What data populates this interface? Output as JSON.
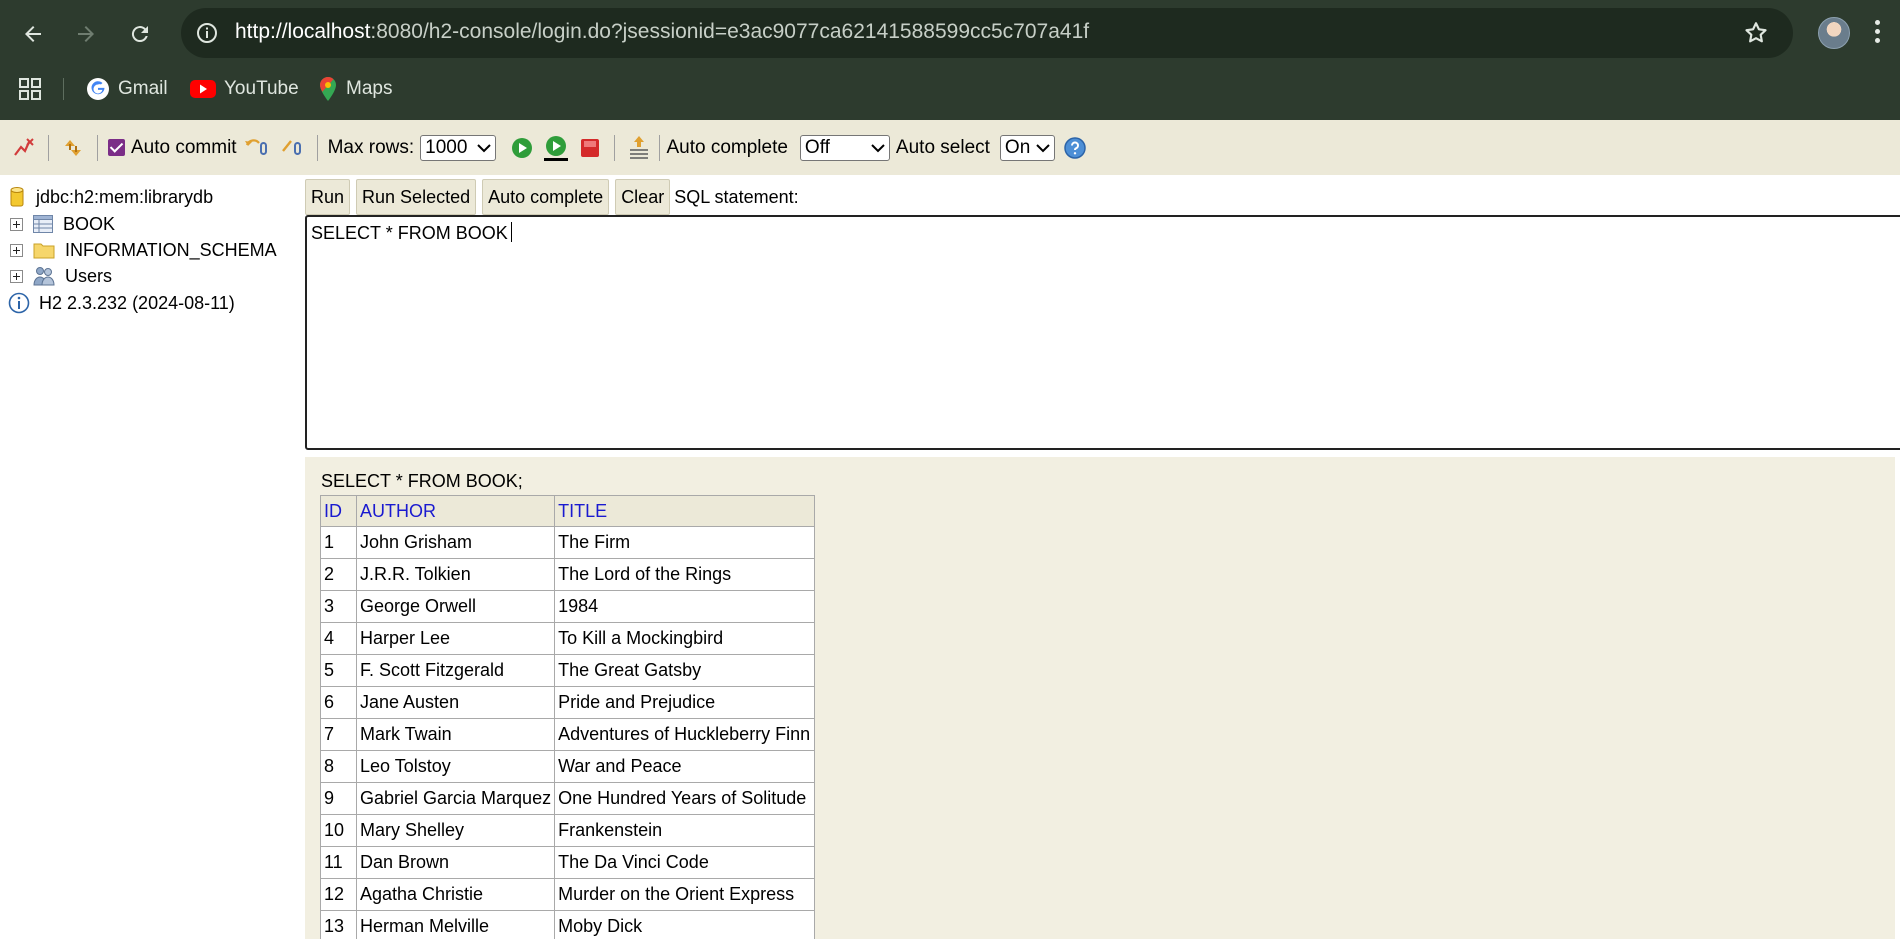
{
  "browser": {
    "url_host": "http://localhost",
    "url_rest": ":8080/h2-console/login.do?jsessionid=e3ac9077ca62141588599cc5c707a41f",
    "bookmarks": [
      {
        "label": "Gmail",
        "icon": "google-icon"
      },
      {
        "label": "YouTube",
        "icon": "youtube-icon"
      },
      {
        "label": "Maps",
        "icon": "maps-icon"
      }
    ]
  },
  "toolbar": {
    "auto_commit_label": "Auto commit",
    "auto_commit_checked": true,
    "max_rows_label": "Max rows:",
    "max_rows_value": "1000",
    "auto_complete_label": "Auto complete",
    "auto_complete_value": "Off",
    "auto_select_label": "Auto select",
    "auto_select_value": "On"
  },
  "tree": {
    "connection": "jdbc:h2:mem:librarydb",
    "nodes": [
      "BOOK",
      "INFORMATION_SCHEMA",
      "Users"
    ],
    "version": "H2 2.3.232 (2024-08-11)"
  },
  "editor": {
    "buttons": {
      "run": "Run",
      "run_selected": "Run Selected",
      "auto_complete": "Auto complete",
      "clear": "Clear"
    },
    "label": "SQL statement:",
    "text": "SELECT * FROM BOOK"
  },
  "result": {
    "query": "SELECT * FROM BOOK;",
    "columns": [
      "ID",
      "AUTHOR",
      "TITLE"
    ],
    "rows": [
      [
        "1",
        "John Grisham",
        "The Firm"
      ],
      [
        "2",
        "J.R.R. Tolkien",
        "The Lord of the Rings"
      ],
      [
        "3",
        "George Orwell",
        "1984"
      ],
      [
        "4",
        "Harper Lee",
        "To Kill a Mockingbird"
      ],
      [
        "5",
        "F. Scott Fitzgerald",
        "The Great Gatsby"
      ],
      [
        "6",
        "Jane Austen",
        "Pride and Prejudice"
      ],
      [
        "7",
        "Mark Twain",
        "Adventures of Huckleberry Finn"
      ],
      [
        "8",
        "Leo Tolstoy",
        "War and Peace"
      ],
      [
        "9",
        "Gabriel Garcia Marquez",
        "One Hundred Years of Solitude"
      ],
      [
        "10",
        "Mary Shelley",
        "Frankenstein"
      ],
      [
        "11",
        "Dan Brown",
        "The Da Vinci Code"
      ],
      [
        "12",
        "Agatha Christie",
        "Murder on the Orient Express"
      ],
      [
        "13",
        "Herman Melville",
        "Moby Dick"
      ]
    ]
  },
  "colors": {
    "chrome_bg": "#2d3b2e",
    "h2_bg": "#ece9d8",
    "result_bg": "#f2efe1",
    "header_link": "#1a1ad0",
    "checkbox_accent": "#7b2d87"
  }
}
